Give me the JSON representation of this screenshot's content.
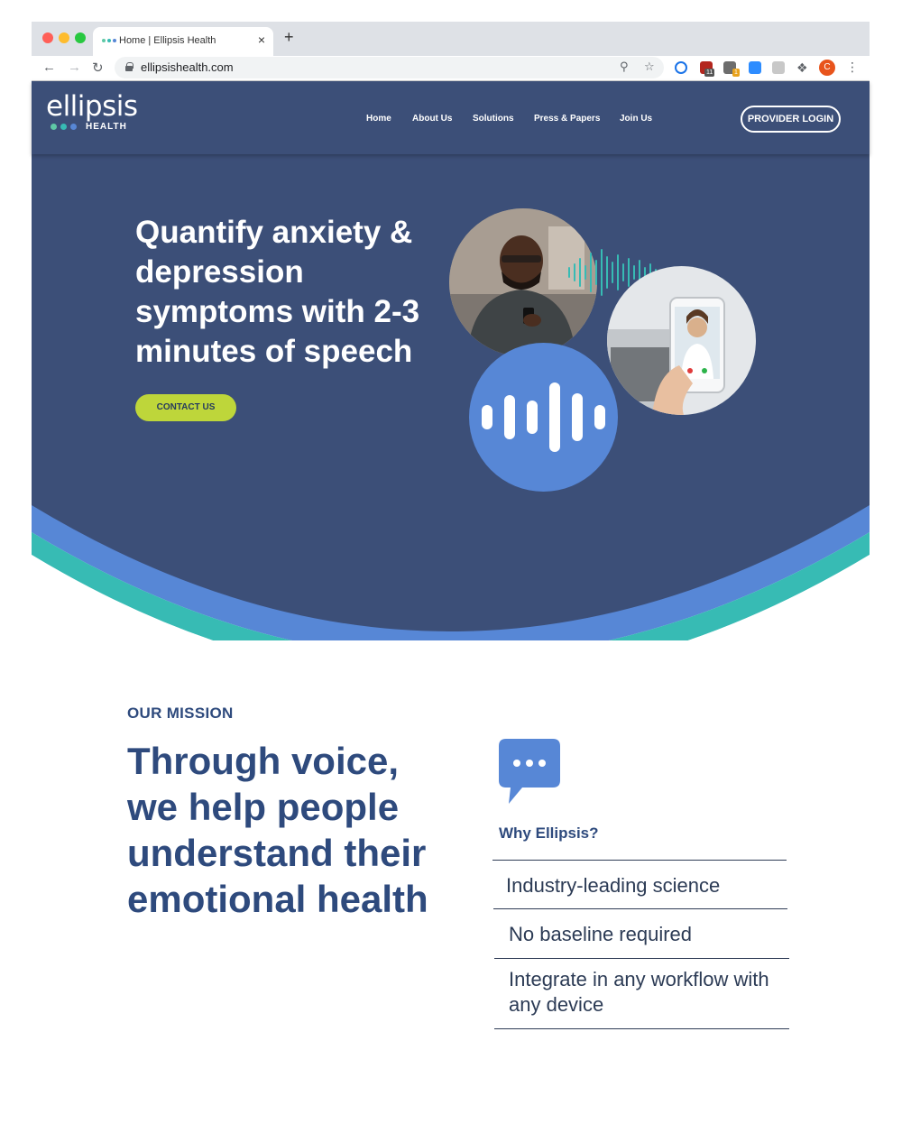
{
  "browser": {
    "tab_title": "Home | Ellipsis Health",
    "tab_close": "×",
    "new_tab": "+",
    "url": "ellipsishealth.com",
    "ext_badge_1": "11",
    "ext_badge_2": "1",
    "avatar_letter": "C"
  },
  "header": {
    "logo_word": "ellipsis",
    "logo_sub": "HEALTH",
    "nav": [
      "Home",
      "About Us",
      "Solutions",
      "Press & Papers",
      "Join Us"
    ],
    "login_label": "PROVIDER LOGIN"
  },
  "hero": {
    "title": "Quantify anxiety & depression symptoms with 2-3 minutes of speech",
    "cta_label": "CONTACT US"
  },
  "mission": {
    "eyebrow": "OUR MISSION",
    "title": "Through voice, we help people understand their emotional health",
    "why_label": "Why Ellipsis?",
    "features": [
      "Industry-leading science",
      "No baseline required",
      "Integrate in any workflow with any device"
    ]
  },
  "colors": {
    "navy": "#3c4f78",
    "heading_blue": "#2e4a7d",
    "accent_blue": "#5787d6",
    "teal": "#37bbb4",
    "lime": "#bed63a"
  }
}
